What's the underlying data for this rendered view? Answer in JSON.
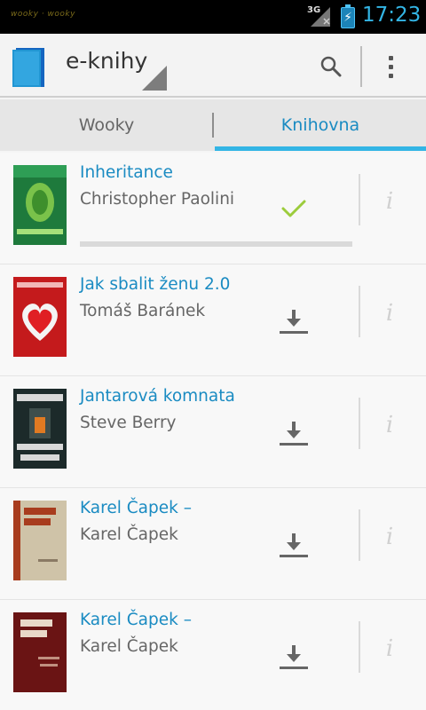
{
  "status_bar": {
    "notification_text": "wooky · wooky",
    "network": "3G",
    "time": "17:23"
  },
  "action_bar": {
    "title": "e-knihy",
    "search_icon": "search-icon",
    "overflow_icon": "more-vert-icon"
  },
  "tabs": [
    {
      "label": "Wooky",
      "selected": false
    },
    {
      "label": "Knihovna",
      "selected": true
    }
  ],
  "books": [
    {
      "title": "Inheritance",
      "author": "Christopher Paolini",
      "status": "downloaded",
      "status_icon": "check-icon",
      "progress": 0,
      "cover_text": "INHERITANCE",
      "cover_colors": [
        "#1e7a3c",
        "#2e9e55"
      ]
    },
    {
      "title": "Jak sbalit ženu 2.0",
      "author": "Tomáš Baránek",
      "status": "not-downloaded",
      "status_icon": "download-icon",
      "cover_text": "jak sbalit ženu 2.0",
      "cover_colors": [
        "#c0181a",
        "#e02a2c"
      ]
    },
    {
      "title": "Jantarová komnata",
      "author": "Steve Berry",
      "status": "not-downloaded",
      "status_icon": "download-icon",
      "cover_text": "STEVE BERRY JANTAROVÁ KOMNATA",
      "cover_colors": [
        "#1c2a2a",
        "#3b4a48"
      ]
    },
    {
      "title": "Karel Čapek –",
      "author": "Karel Čapek",
      "status": "not-downloaded",
      "status_icon": "download-icon",
      "cover_text": "Karel Čapek",
      "cover_colors": [
        "#a83c1e",
        "#cfc3a8"
      ]
    },
    {
      "title": "Karel Čapek –",
      "author": "Karel Čapek",
      "status": "not-downloaded",
      "status_icon": "download-icon",
      "cover_text": "Karel Čapek",
      "cover_colors": [
        "#6a1414",
        "#8a2020"
      ]
    }
  ],
  "info_label": "i",
  "colors": {
    "accent": "#33b5e5",
    "title_blue": "#1a8bc2",
    "check_green": "#9ccc3c",
    "icon_gray": "#666666"
  }
}
